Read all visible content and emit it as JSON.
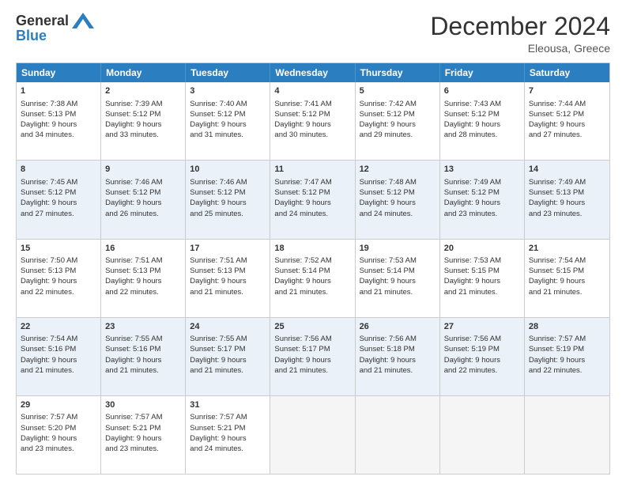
{
  "header": {
    "logo_general": "General",
    "logo_blue": "Blue",
    "month_title": "December 2024",
    "location": "Eleousa, Greece"
  },
  "days": [
    "Sunday",
    "Monday",
    "Tuesday",
    "Wednesday",
    "Thursday",
    "Friday",
    "Saturday"
  ],
  "rows": [
    [
      {
        "day": "1",
        "lines": [
          "Sunrise: 7:38 AM",
          "Sunset: 5:13 PM",
          "Daylight: 9 hours",
          "and 34 minutes."
        ]
      },
      {
        "day": "2",
        "lines": [
          "Sunrise: 7:39 AM",
          "Sunset: 5:12 PM",
          "Daylight: 9 hours",
          "and 33 minutes."
        ]
      },
      {
        "day": "3",
        "lines": [
          "Sunrise: 7:40 AM",
          "Sunset: 5:12 PM",
          "Daylight: 9 hours",
          "and 31 minutes."
        ]
      },
      {
        "day": "4",
        "lines": [
          "Sunrise: 7:41 AM",
          "Sunset: 5:12 PM",
          "Daylight: 9 hours",
          "and 30 minutes."
        ]
      },
      {
        "day": "5",
        "lines": [
          "Sunrise: 7:42 AM",
          "Sunset: 5:12 PM",
          "Daylight: 9 hours",
          "and 29 minutes."
        ]
      },
      {
        "day": "6",
        "lines": [
          "Sunrise: 7:43 AM",
          "Sunset: 5:12 PM",
          "Daylight: 9 hours",
          "and 28 minutes."
        ]
      },
      {
        "day": "7",
        "lines": [
          "Sunrise: 7:44 AM",
          "Sunset: 5:12 PM",
          "Daylight: 9 hours",
          "and 27 minutes."
        ]
      }
    ],
    [
      {
        "day": "8",
        "lines": [
          "Sunrise: 7:45 AM",
          "Sunset: 5:12 PM",
          "Daylight: 9 hours",
          "and 27 minutes."
        ]
      },
      {
        "day": "9",
        "lines": [
          "Sunrise: 7:46 AM",
          "Sunset: 5:12 PM",
          "Daylight: 9 hours",
          "and 26 minutes."
        ]
      },
      {
        "day": "10",
        "lines": [
          "Sunrise: 7:46 AM",
          "Sunset: 5:12 PM",
          "Daylight: 9 hours",
          "and 25 minutes."
        ]
      },
      {
        "day": "11",
        "lines": [
          "Sunrise: 7:47 AM",
          "Sunset: 5:12 PM",
          "Daylight: 9 hours",
          "and 24 minutes."
        ]
      },
      {
        "day": "12",
        "lines": [
          "Sunrise: 7:48 AM",
          "Sunset: 5:12 PM",
          "Daylight: 9 hours",
          "and 24 minutes."
        ]
      },
      {
        "day": "13",
        "lines": [
          "Sunrise: 7:49 AM",
          "Sunset: 5:12 PM",
          "Daylight: 9 hours",
          "and 23 minutes."
        ]
      },
      {
        "day": "14",
        "lines": [
          "Sunrise: 7:49 AM",
          "Sunset: 5:13 PM",
          "Daylight: 9 hours",
          "and 23 minutes."
        ]
      }
    ],
    [
      {
        "day": "15",
        "lines": [
          "Sunrise: 7:50 AM",
          "Sunset: 5:13 PM",
          "Daylight: 9 hours",
          "and 22 minutes."
        ]
      },
      {
        "day": "16",
        "lines": [
          "Sunrise: 7:51 AM",
          "Sunset: 5:13 PM",
          "Daylight: 9 hours",
          "and 22 minutes."
        ]
      },
      {
        "day": "17",
        "lines": [
          "Sunrise: 7:51 AM",
          "Sunset: 5:13 PM",
          "Daylight: 9 hours",
          "and 21 minutes."
        ]
      },
      {
        "day": "18",
        "lines": [
          "Sunrise: 7:52 AM",
          "Sunset: 5:14 PM",
          "Daylight: 9 hours",
          "and 21 minutes."
        ]
      },
      {
        "day": "19",
        "lines": [
          "Sunrise: 7:53 AM",
          "Sunset: 5:14 PM",
          "Daylight: 9 hours",
          "and 21 minutes."
        ]
      },
      {
        "day": "20",
        "lines": [
          "Sunrise: 7:53 AM",
          "Sunset: 5:15 PM",
          "Daylight: 9 hours",
          "and 21 minutes."
        ]
      },
      {
        "day": "21",
        "lines": [
          "Sunrise: 7:54 AM",
          "Sunset: 5:15 PM",
          "Daylight: 9 hours",
          "and 21 minutes."
        ]
      }
    ],
    [
      {
        "day": "22",
        "lines": [
          "Sunrise: 7:54 AM",
          "Sunset: 5:16 PM",
          "Daylight: 9 hours",
          "and 21 minutes."
        ]
      },
      {
        "day": "23",
        "lines": [
          "Sunrise: 7:55 AM",
          "Sunset: 5:16 PM",
          "Daylight: 9 hours",
          "and 21 minutes."
        ]
      },
      {
        "day": "24",
        "lines": [
          "Sunrise: 7:55 AM",
          "Sunset: 5:17 PM",
          "Daylight: 9 hours",
          "and 21 minutes."
        ]
      },
      {
        "day": "25",
        "lines": [
          "Sunrise: 7:56 AM",
          "Sunset: 5:17 PM",
          "Daylight: 9 hours",
          "and 21 minutes."
        ]
      },
      {
        "day": "26",
        "lines": [
          "Sunrise: 7:56 AM",
          "Sunset: 5:18 PM",
          "Daylight: 9 hours",
          "and 21 minutes."
        ]
      },
      {
        "day": "27",
        "lines": [
          "Sunrise: 7:56 AM",
          "Sunset: 5:19 PM",
          "Daylight: 9 hours",
          "and 22 minutes."
        ]
      },
      {
        "day": "28",
        "lines": [
          "Sunrise: 7:57 AM",
          "Sunset: 5:19 PM",
          "Daylight: 9 hours",
          "and 22 minutes."
        ]
      }
    ],
    [
      {
        "day": "29",
        "lines": [
          "Sunrise: 7:57 AM",
          "Sunset: 5:20 PM",
          "Daylight: 9 hours",
          "and 23 minutes."
        ]
      },
      {
        "day": "30",
        "lines": [
          "Sunrise: 7:57 AM",
          "Sunset: 5:21 PM",
          "Daylight: 9 hours",
          "and 23 minutes."
        ]
      },
      {
        "day": "31",
        "lines": [
          "Sunrise: 7:57 AM",
          "Sunset: 5:21 PM",
          "Daylight: 9 hours",
          "and 24 minutes."
        ]
      },
      null,
      null,
      null,
      null
    ]
  ]
}
